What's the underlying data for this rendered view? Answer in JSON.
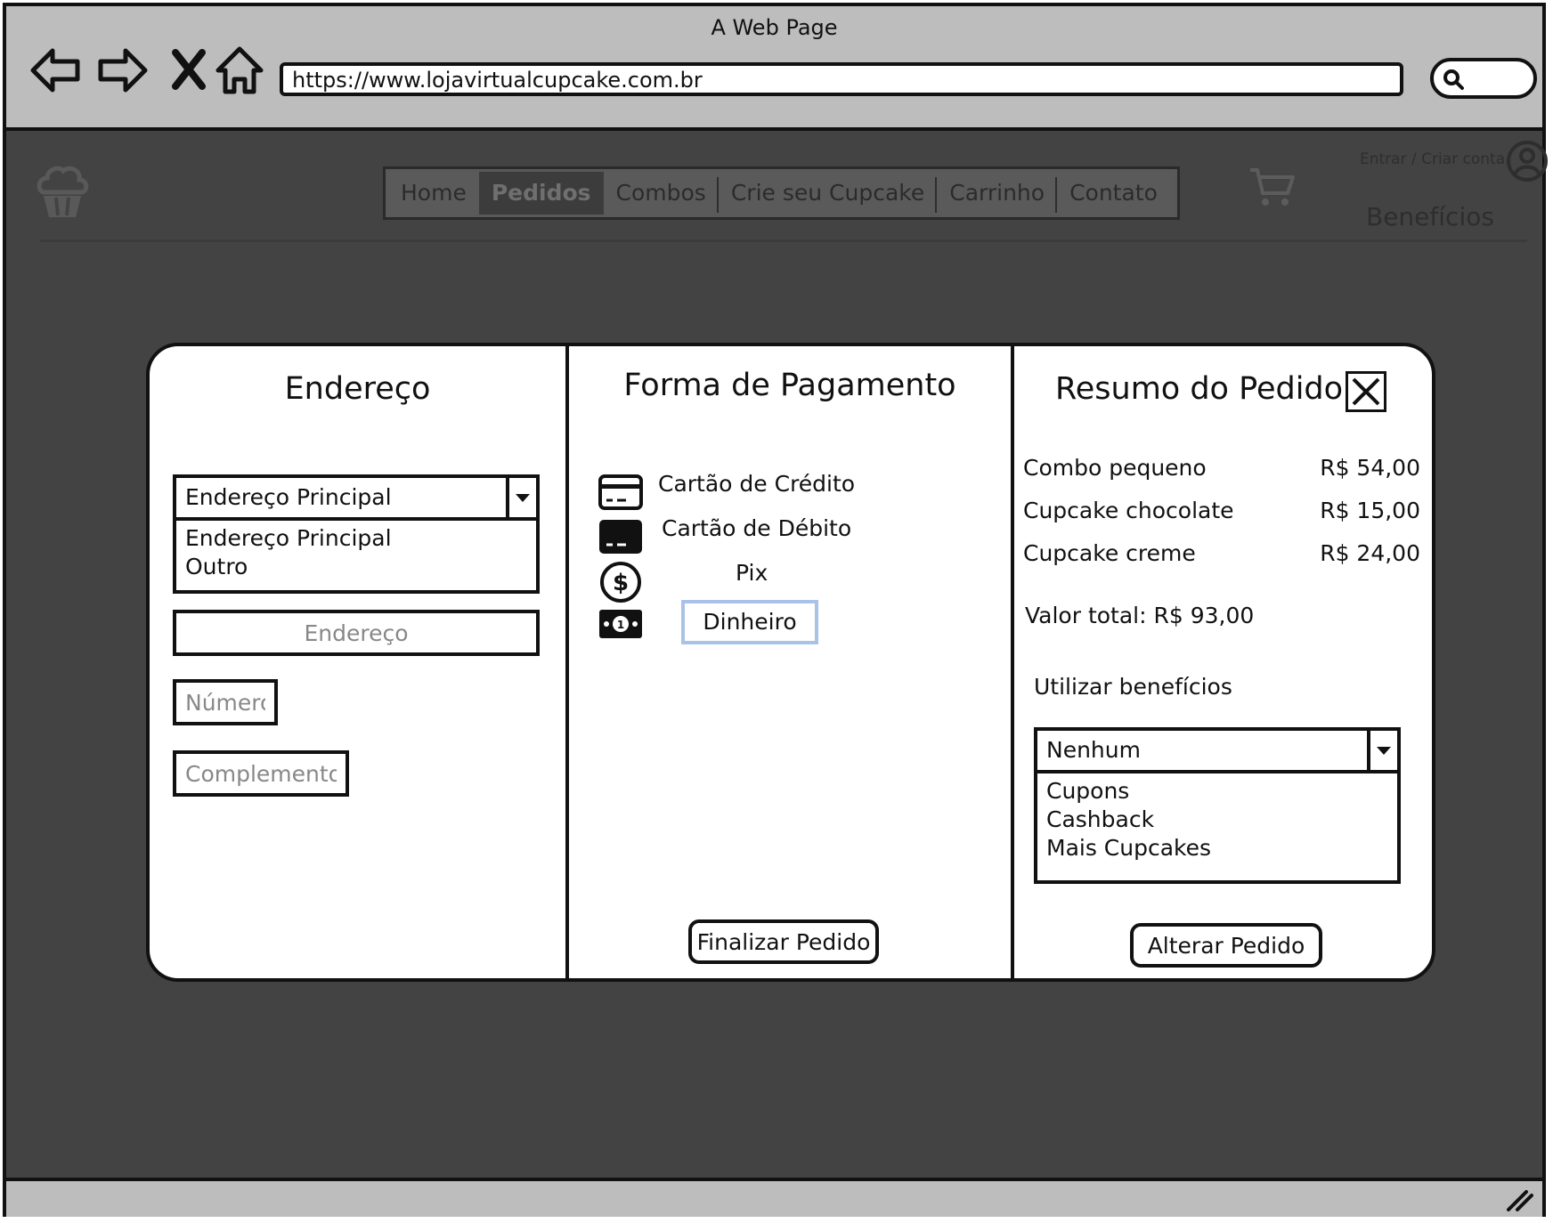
{
  "window": {
    "title": "A Web Page",
    "url": "https://www.lojavirtualcupcake.com.br"
  },
  "nav": {
    "tabs": [
      "Home",
      "Pedidos",
      "Combos",
      "Crie seu Cupcake",
      "Carrinho",
      "Contato"
    ],
    "active_tab": "Pedidos",
    "login": "Entrar / Criar conta",
    "benefits": "Benefícios"
  },
  "address": {
    "title": "Endereço",
    "select_value": "Endereço Principal",
    "options": [
      "Endereço Principal",
      "Outro"
    ],
    "street_placeholder": "Endereço",
    "number_placeholder": "Número",
    "complement_placeholder": "Complemento"
  },
  "payment": {
    "title": "Forma de Pagamento",
    "methods": [
      "Cartão de Crédito",
      "Cartão de Débito",
      "Pix",
      "Dinheiro"
    ],
    "selected": "Dinheiro",
    "finish_label": "Finalizar Pedido"
  },
  "summary": {
    "title": "Resumo do Pedido",
    "items": [
      {
        "name": "Combo pequeno",
        "price": "R$ 54,00"
      },
      {
        "name": "Cupcake chocolate",
        "price": "R$ 15,00"
      },
      {
        "name": "Cupcake creme",
        "price": "R$ 24,00"
      }
    ],
    "total": "Valor total: R$ 93,00",
    "benefits_label": "Utilizar benefícios",
    "benefits_value": "Nenhum",
    "benefits_options": [
      "Cupons",
      "Cashback",
      "Mais Cupcakes"
    ],
    "alter_label": "Alterar Pedido"
  },
  "icons": {
    "back": "back-arrow-icon",
    "forward": "forward-arrow-icon",
    "stop": "close-x-icon",
    "home": "home-icon",
    "search": "search-icon",
    "logo": "cupcake-icon",
    "cart": "cart-icon",
    "account": "user-icon",
    "credit": "credit-card-icon",
    "debit": "debit-card-icon",
    "pix": "dollar-coin-icon",
    "cash": "banknote-icon",
    "close": "close-icon",
    "resize": "resize-grip-icon"
  },
  "colors": {
    "chrome": "#bdbdbd",
    "page_bg": "#434343",
    "selection_outline": "#a9c3e8"
  }
}
